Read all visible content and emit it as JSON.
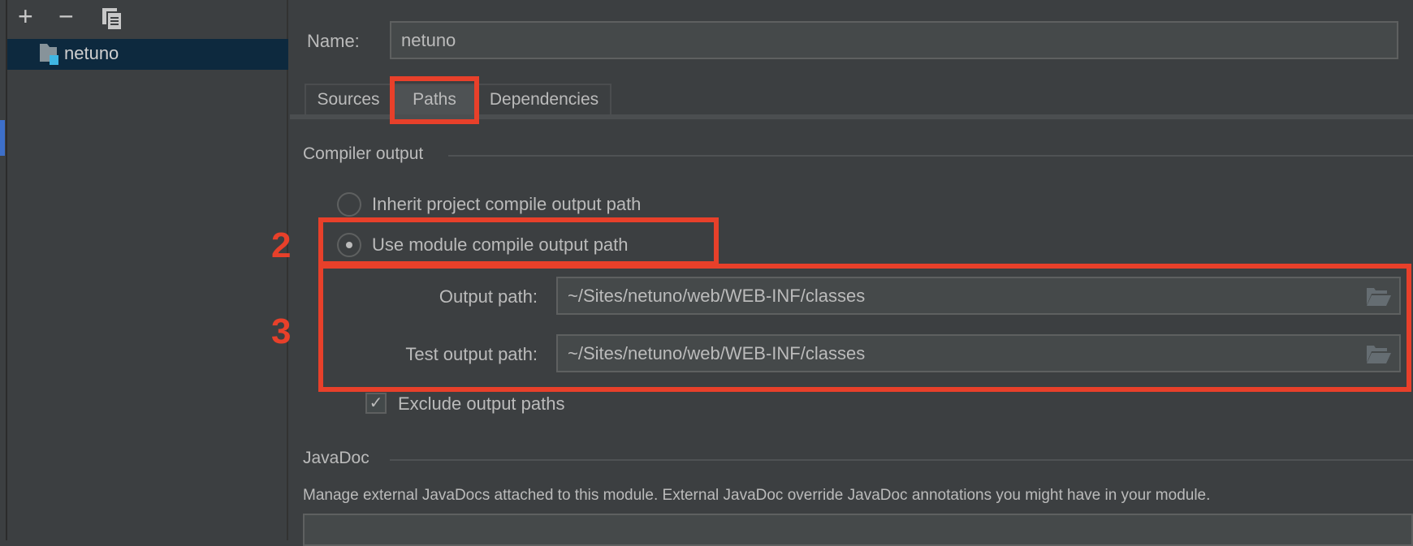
{
  "toolbar": {
    "add": "+",
    "remove": "−",
    "copy_icon": "copy-icon"
  },
  "tree": {
    "items": [
      {
        "label": "netuno",
        "icon": "module-folder-icon"
      }
    ]
  },
  "name": {
    "label": "Name:",
    "value": "netuno"
  },
  "tabs": [
    {
      "label": "Sources"
    },
    {
      "label": "Paths",
      "selected": true
    },
    {
      "label": "Dependencies"
    }
  ],
  "compiler": {
    "title": "Compiler output",
    "options": [
      {
        "label": "Inherit project compile output path",
        "selected": false
      },
      {
        "label": "Use module compile output path",
        "selected": true
      }
    ],
    "output_label": "Output path:",
    "output_value": "~/Sites/netuno/web/WEB-INF/classes",
    "test_label": "Test output path:",
    "test_value": "~/Sites/netuno/web/WEB-INF/classes",
    "exclude_label": "Exclude output paths",
    "exclude_checked": true
  },
  "javadoc": {
    "title": "JavaDoc",
    "description": "Manage external JavaDocs attached to this module. External JavaDoc override JavaDoc annotations you might have in your module."
  },
  "annotations": {
    "step2": "2",
    "step3": "3",
    "color": "#e8402a"
  }
}
